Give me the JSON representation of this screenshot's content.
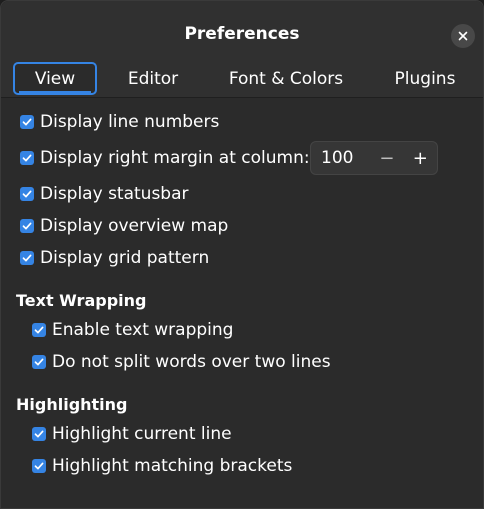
{
  "window": {
    "title": "Preferences"
  },
  "tabs": [
    {
      "label": "View",
      "active": true
    },
    {
      "label": "Editor",
      "active": false
    },
    {
      "label": "Font & Colors",
      "active": false
    },
    {
      "label": "Plugins",
      "active": false
    }
  ],
  "view": {
    "options": [
      {
        "label": "Display line numbers",
        "checked": true
      },
      {
        "label": "Display right margin at column:",
        "checked": true
      },
      {
        "label": "Display statusbar",
        "checked": true
      },
      {
        "label": "Display overview map",
        "checked": true
      },
      {
        "label": "Display grid pattern",
        "checked": true
      }
    ],
    "right_margin": {
      "value": "100",
      "decrement": "−",
      "increment": "+"
    },
    "text_wrapping": {
      "heading": "Text Wrapping",
      "options": [
        {
          "label": "Enable text wrapping",
          "checked": true
        },
        {
          "label": "Do not split words over two lines",
          "checked": true
        }
      ]
    },
    "highlighting": {
      "heading": "Highlighting",
      "options": [
        {
          "label": "Highlight current line",
          "checked": true
        },
        {
          "label": "Highlight matching brackets",
          "checked": true
        }
      ]
    }
  },
  "colors": {
    "accent": "#3584e4",
    "window_bg": "#2b2b2b",
    "header_bg": "#303030"
  },
  "icons": {
    "close": "close-icon",
    "checkbox": "checkmark-icon"
  }
}
